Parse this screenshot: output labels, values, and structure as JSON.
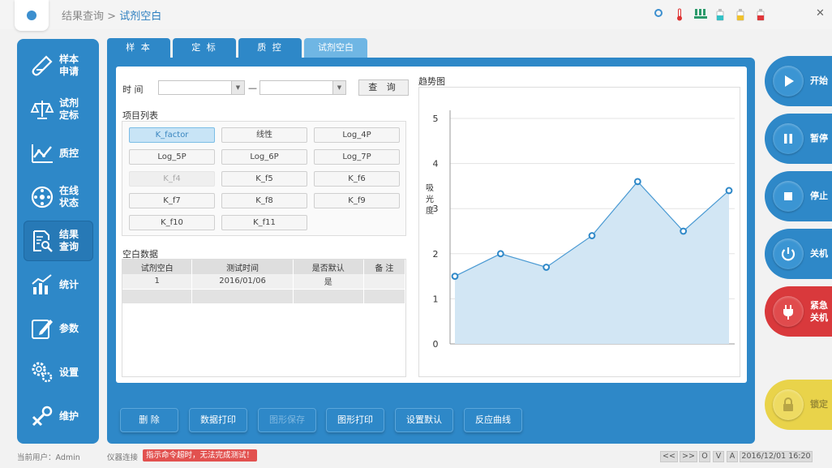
{
  "header": {
    "breadcrumb_parent": "结果查询",
    "breadcrumb_sep": " > ",
    "breadcrumb_current": "试剂空白",
    "close": "✕"
  },
  "sidebar": {
    "items": [
      {
        "label": "样本\n申请",
        "icon": "test-tube-icon"
      },
      {
        "label": "试剂\n定标",
        "icon": "scale-icon"
      },
      {
        "label": "质控",
        "icon": "chart-line-icon"
      },
      {
        "label": "在线\n状态",
        "icon": "rotor-icon"
      },
      {
        "label": "结果\n查询",
        "icon": "document-search-icon"
      },
      {
        "label": "统计",
        "icon": "bar-chart-icon"
      },
      {
        "label": "参数",
        "icon": "edit-icon"
      },
      {
        "label": "设置",
        "icon": "gears-icon"
      },
      {
        "label": "维护",
        "icon": "tools-icon"
      }
    ]
  },
  "tabs": [
    "样 本",
    "定 标",
    "质 控",
    "试剂空白"
  ],
  "filter": {
    "time_label": "时 间",
    "from": "",
    "to": "",
    "dash": "—",
    "query": "查 询"
  },
  "items_title": "项目列表",
  "items": [
    "K_factor",
    "线性",
    "Log_4P",
    "Log_5P",
    "Log_6P",
    "Log_7P",
    "K_f4",
    "K_f5",
    "K_f6",
    "K_f7",
    "K_f8",
    "K_f9",
    "K_f10",
    "K_f11"
  ],
  "blank_title": "空白数据",
  "table": {
    "headers": [
      "试剂空白",
      "测试时间",
      "是否默认",
      "备 注"
    ],
    "rows": [
      [
        "1",
        "2016/01/06",
        "是",
        ""
      ],
      [
        "",
        "",
        "",
        ""
      ]
    ]
  },
  "chart_title": "趋势图",
  "chart_data": {
    "type": "area",
    "x": [
      1,
      2,
      3,
      4,
      5,
      6,
      7
    ],
    "values": [
      1.5,
      2.0,
      1.7,
      2.4,
      3.6,
      2.5,
      3.4
    ],
    "ylabel": "吸\n光\n度",
    "ylim": [
      0,
      5
    ],
    "yticks": [
      0,
      1,
      2,
      3,
      4,
      5
    ],
    "grid": true,
    "color": "#2e88c8"
  },
  "actions": [
    "删 除",
    "数据打印",
    "图形保存",
    "图形打印",
    "设置默认",
    "反应曲线"
  ],
  "right_buttons": [
    "开始",
    "暂停",
    "停止",
    "关机",
    "紧急\n关机",
    "锁定"
  ],
  "status": {
    "user": "当前用户：Admin",
    "conn_label": "仪器连接",
    "error": "指示命令超时，无法完成测试！",
    "nav": [
      "<<",
      ">>",
      "O",
      "V",
      "A"
    ],
    "datetime": "2016/12/01 16:20"
  },
  "colors": {
    "primary": "#2e88c8",
    "danger": "#d9393c",
    "lock": "#e9d34a"
  }
}
